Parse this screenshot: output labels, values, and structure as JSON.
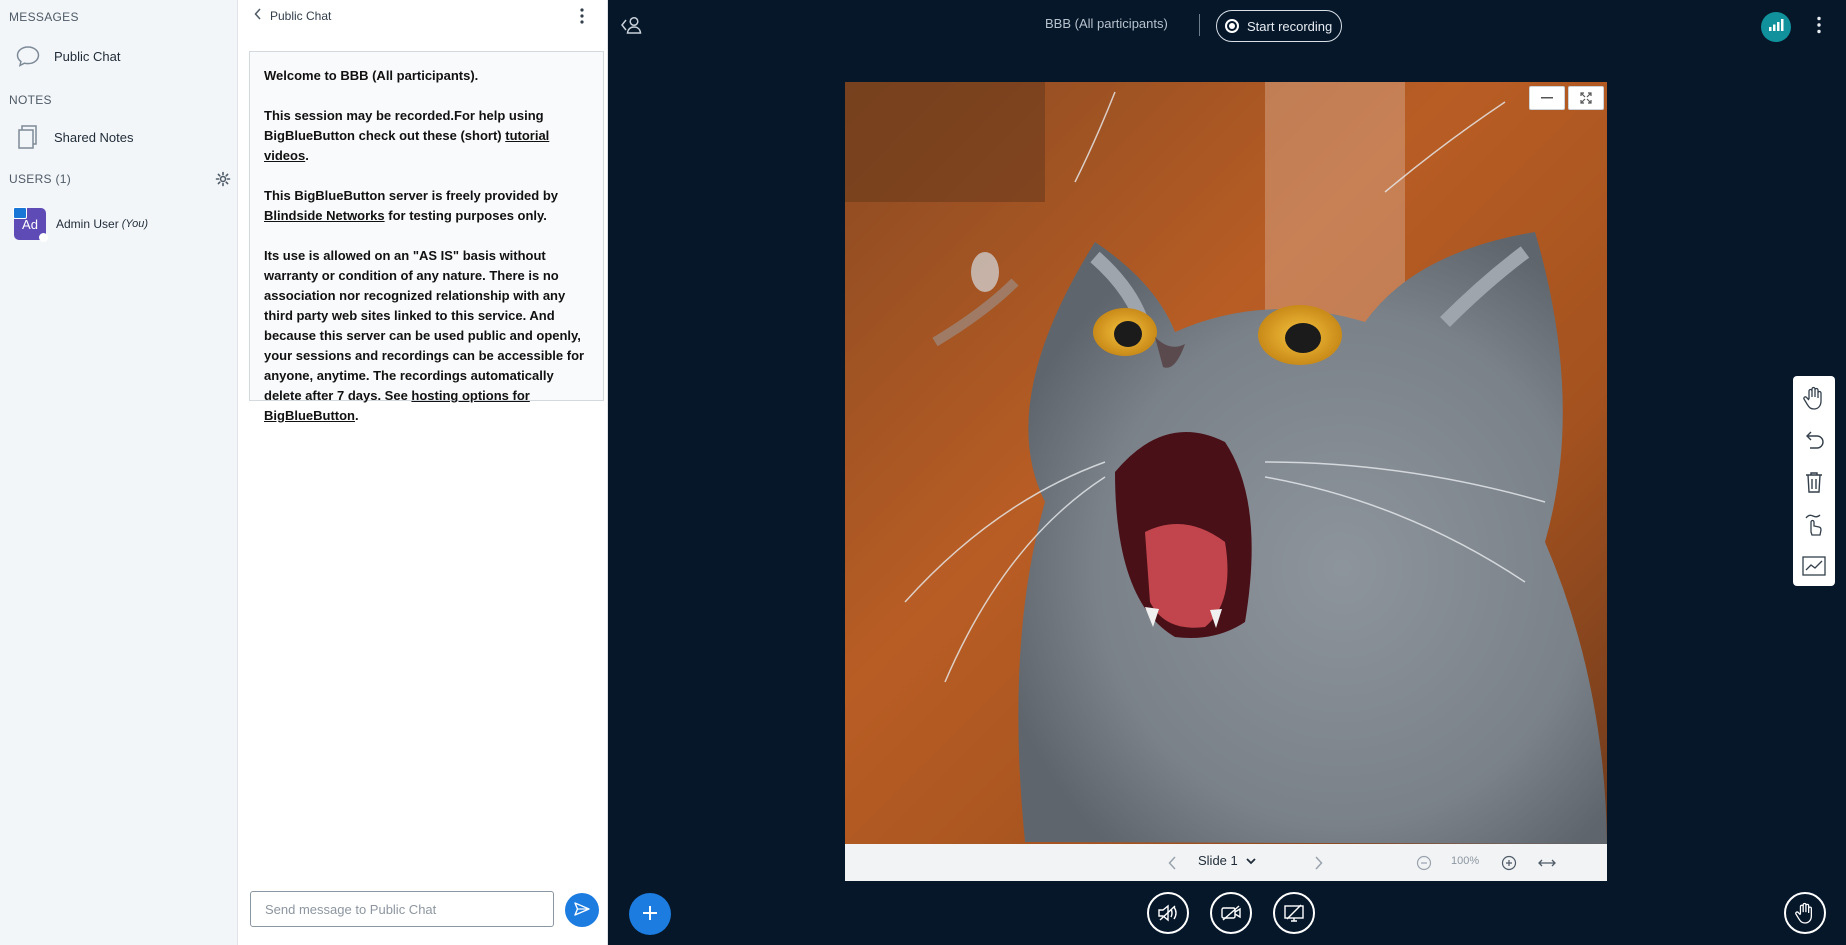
{
  "sidebar": {
    "messages_title": "MESSAGES",
    "public_chat_label": "Public Chat",
    "notes_title": "NOTES",
    "shared_notes_label": "Shared Notes",
    "users_title": "USERS (1)",
    "user": {
      "initials": "Ad",
      "name": "Admin User",
      "you_tag": "(You)"
    }
  },
  "chat": {
    "header_label": "Public Chat",
    "welcome": {
      "line1": "Welcome to BBB (All participants).",
      "p2_text": "This session may be recorded.For help using BigBlueButton check out these (short) ",
      "p2_link": "tutorial videos",
      "p2_end": ".",
      "p3_text": "This BigBlueButton server is freely provided by ",
      "p3_link": "Blindside Networks",
      "p3_end": " for testing purposes only.",
      "p4_text": "Its use is allowed on an \"AS IS\" basis without warranty or condition of any nature. There is no association nor recognized relationship with any third party web sites linked to this service. And because this server can be used public and openly, your sessions and recordings can be accessible for anyone, anytime. The recordings automatically delete after 7 days. See ",
      "p4_link": "hosting options for BigBlueButton",
      "p4_end": "."
    },
    "input_placeholder": "Send message to Public Chat"
  },
  "header": {
    "meeting_title": "BBB (All participants)",
    "record_label": "Start recording"
  },
  "presentation": {
    "slide_label": "Slide 1",
    "zoom_level": "100%"
  },
  "colors": {
    "background": "#06172a",
    "accent": "#1c7ce0",
    "connection": "#10919b",
    "avatar": "#5e4bb5"
  }
}
